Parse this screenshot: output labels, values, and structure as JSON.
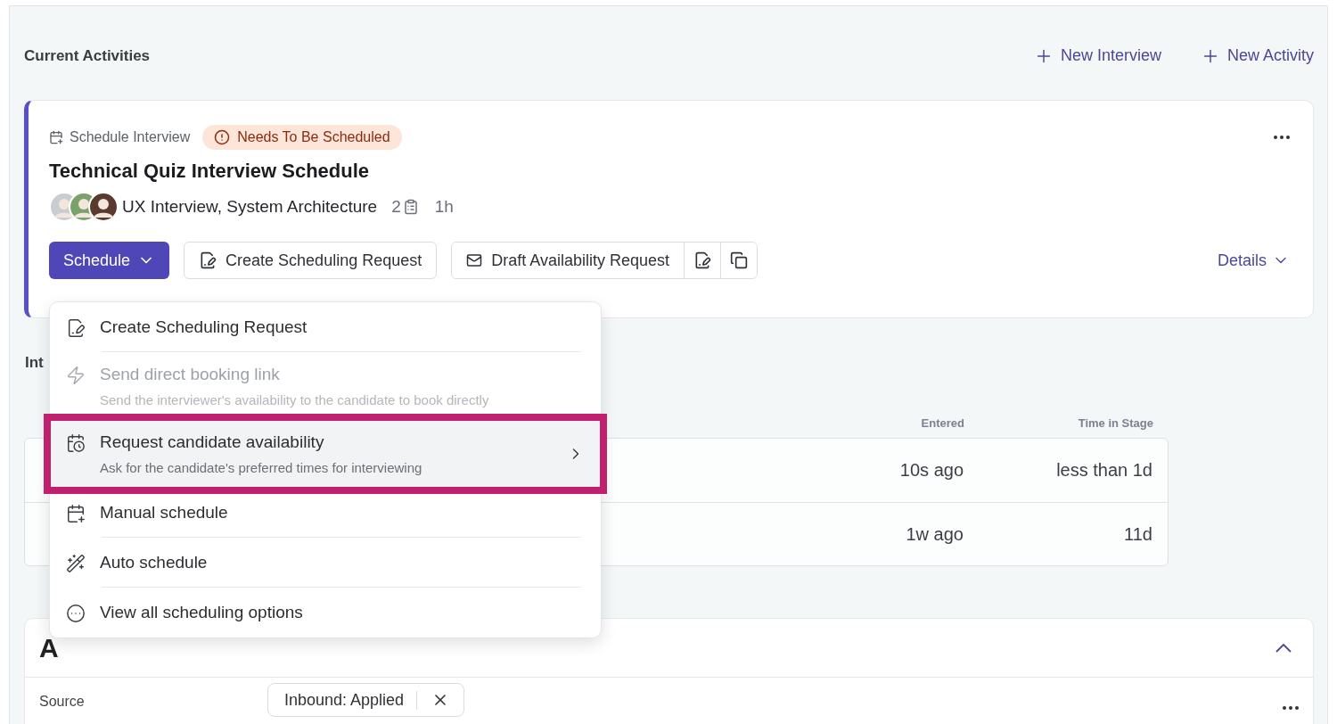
{
  "header": {
    "title": "Current Activities",
    "actions": [
      {
        "label": "New Interview"
      },
      {
        "label": "New Activity"
      }
    ]
  },
  "activity_card": {
    "type_label": "Schedule Interview",
    "status": "Needs To Be Scheduled",
    "title": "Technical Quiz Interview Schedule",
    "interviews": "UX Interview, System Architecture",
    "count": "2",
    "duration": "1h",
    "schedule_button": "Schedule",
    "request_button": "Create Scheduling Request",
    "draft_button": "Draft Availability Request",
    "details_link": "Details"
  },
  "schedule_menu": {
    "expanded": true,
    "items": [
      {
        "label": "Create Scheduling Request",
        "disabled": false,
        "selected": false,
        "submenu": false
      },
      {
        "label": "Send direct booking link",
        "description": "Send the interviewer's availability to the candidate to book directly",
        "disabled": true,
        "selected": false,
        "submenu": false
      },
      {
        "label": "Request candidate availability",
        "description": "Ask for the candidate's preferred times for interviewing",
        "disabled": false,
        "selected": true,
        "submenu": true
      },
      {
        "label": "Manual schedule",
        "disabled": false,
        "selected": false,
        "submenu": false
      },
      {
        "label": "Auto schedule",
        "disabled": false,
        "selected": false,
        "submenu": false
      },
      {
        "label": "View all scheduling options",
        "disabled": false,
        "selected": false,
        "submenu": false
      }
    ]
  },
  "section_heading": "Int",
  "stages_table": {
    "columns": [
      "Entered",
      "Time in Stage"
    ],
    "rows": [
      {
        "entered": "10s ago",
        "time_in_stage": "less than 1d"
      },
      {
        "entered": "1w ago",
        "time_in_stage": "11d"
      }
    ]
  },
  "details_card": {
    "heading": "A",
    "expanded": true,
    "fields": [
      {
        "label": "Source",
        "value": "Inbound: Applied"
      }
    ]
  }
}
